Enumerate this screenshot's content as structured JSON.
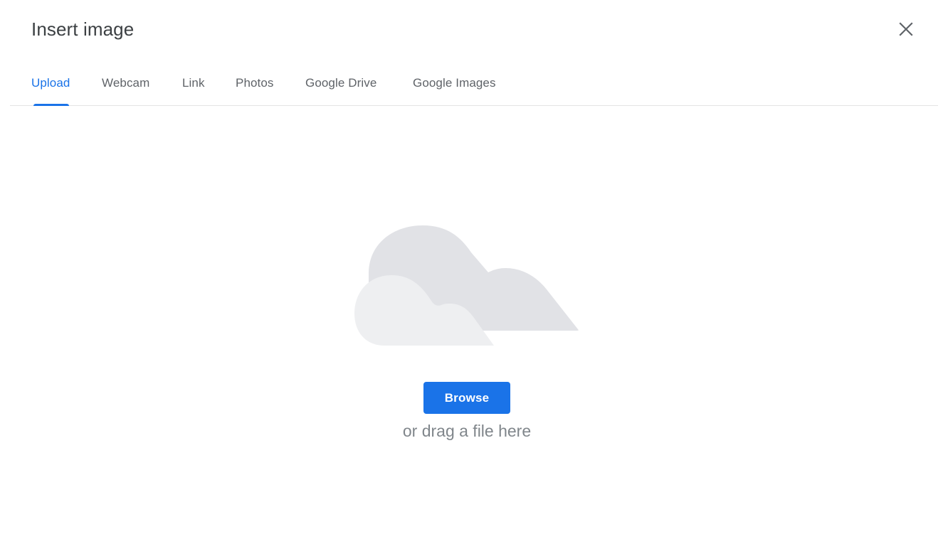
{
  "dialog": {
    "title": "Insert image",
    "close_icon": "close-icon"
  },
  "tabs": [
    {
      "label": "Upload",
      "active": true
    },
    {
      "label": "Webcam",
      "active": false
    },
    {
      "label": "Link",
      "active": false
    },
    {
      "label": "Photos",
      "active": false
    },
    {
      "label": "Google Drive",
      "active": false
    },
    {
      "label": "Google Images",
      "active": false
    }
  ],
  "upload": {
    "illustration_icon": "cloud-icon",
    "browse_label": "Browse",
    "drag_hint": "or drag a file here"
  },
  "colors": {
    "accent": "#1a73e8",
    "title_text": "#3c4043",
    "tab_text": "#5f6368",
    "hint_text": "#80868b",
    "cloud_back": "#e1e2e6",
    "cloud_front": "#eeeff1"
  }
}
